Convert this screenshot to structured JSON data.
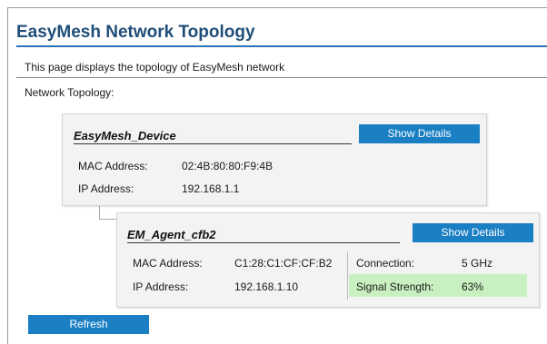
{
  "page": {
    "title": "EasyMesh Network Topology",
    "description": "This page displays the topology of EasyMesh network",
    "section_label": "Network Topology:"
  },
  "controller": {
    "name": "EasyMesh_Device",
    "details_button": "Show Details",
    "mac_label": "MAC Address:",
    "mac_value": "02:4B:80:80:F9:4B",
    "ip_label": "IP Address:",
    "ip_value": "192.168.1.1"
  },
  "agent": {
    "name": "EM_Agent_cfb2",
    "details_button": "Show Details",
    "mac_label": "MAC Address:",
    "mac_value": "C1:28:C1:CF:CF:B2",
    "ip_label": "IP Address:",
    "ip_value": "192.168.1.10",
    "connection_label": "Connection:",
    "connection_value": "5 GHz",
    "signal_label": "Signal Strength:",
    "signal_value": "63%"
  },
  "actions": {
    "refresh_label": "Refresh"
  },
  "colors": {
    "title": "#1f4e79",
    "title_rule": "#2b72b8",
    "button": "#1b7fc4",
    "card_background": "#f3f3f3",
    "signal_highlight": "#c9f0c0"
  }
}
